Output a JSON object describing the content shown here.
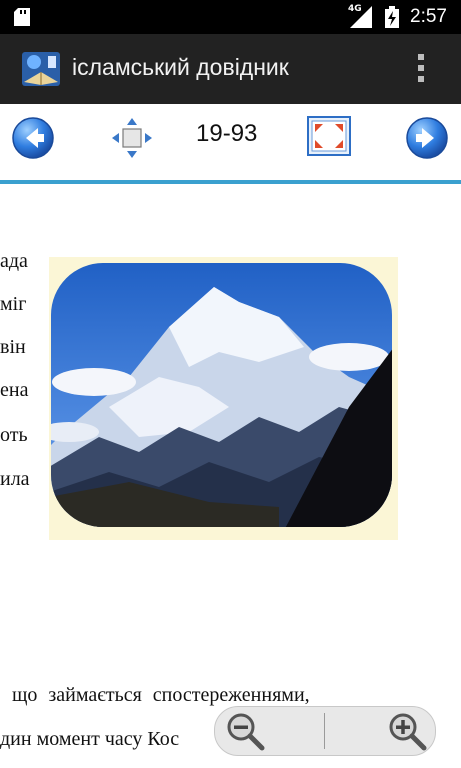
{
  "status_bar": {
    "network": "4G",
    "time": "2:57"
  },
  "action_bar": {
    "title": "ісламський довідник"
  },
  "toolbar": {
    "page": "19-93"
  },
  "content": {
    "left_fragments": [
      "ада",
      "міг",
      "він",
      "ена",
      "оть",
      "ила"
    ],
    "bottom_lines": [
      "що займається спостереженнями,",
      "дин момент часу Кос"
    ]
  },
  "colors": {
    "accent_line": "#3aa0cf",
    "action_bar": "#222222",
    "image_frame": "#fbf6d6"
  },
  "icons": {
    "prev": "arrow-left-icon",
    "next": "arrow-right-icon",
    "move": "move-arrows-icon",
    "fullscreen": "fullscreen-icon",
    "zoom_out": "zoom-out-icon",
    "zoom_in": "zoom-in-icon"
  }
}
